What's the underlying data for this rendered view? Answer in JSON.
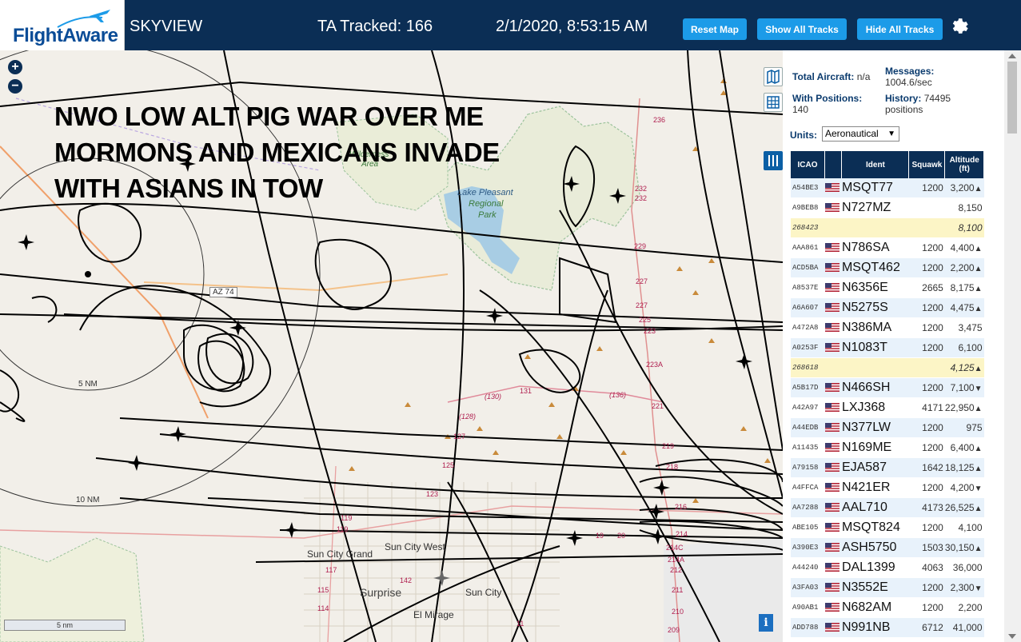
{
  "header": {
    "logo_text": "FlightAware",
    "app_name": "SKYVIEW",
    "tracked": "TA Tracked: 166",
    "clock": "2/1/2020, 8:53:15 AM",
    "buttons": {
      "reset": "Reset Map",
      "show": "Show All Tracks",
      "hide": "Hide All Tracks"
    },
    "colors": {
      "bar": "#0b2e55",
      "button": "#1c9be8"
    }
  },
  "map": {
    "banner_lines": [
      "NWO LOW ALT PIG WAR OVER ME",
      "MORMONS AND MEXICANS INVADE",
      "WITH ASIANS IN TOW"
    ],
    "zoom_in": "+",
    "zoom_out": "−",
    "info": "i",
    "scale": "5 nm",
    "ring_labels": [
      "5 NM",
      "10 NM"
    ],
    "places": {
      "lake": "Lake Pleasant",
      "park": "Regional",
      "park2": "Park",
      "wilderness": "Wilderness",
      "area": "Area",
      "sun_city_grand": "Sun City Grand",
      "sun_city_west": "Sun City West",
      "surprise": "Surprise",
      "sun_city": "Sun City",
      "el_mirage": "El Mirage"
    },
    "routes": {
      "az74": "AZ 74",
      "r236": "236",
      "r232a": "232",
      "r232b": "232",
      "r229": "229",
      "r227a": "227",
      "r227b": "227",
      "r225": "225",
      "r223": "223",
      "r223a": "223A",
      "r221": "221",
      "r219": "219",
      "r218": "218",
      "r216": "216",
      "r214": "214",
      "r214c": "214C",
      "r214a": "214A",
      "r212": "212",
      "r211": "211",
      "r210": "210",
      "r209": "209",
      "r131": "131",
      "r130": "(130)",
      "r136": "(136)",
      "r128": "(128)",
      "r127": "127",
      "r125": "125",
      "r123": "123",
      "r119a": "119",
      "r119b": "119",
      "r117": "117",
      "r115": "115",
      "r114": "114",
      "r142": "142",
      "r19": "19",
      "r20": "20",
      "r11": "11"
    }
  },
  "panel": {
    "total_aircraft_label": "Total Aircraft:",
    "total_aircraft_value": "n/a",
    "with_positions_label": "With Positions:",
    "with_positions_value": "140",
    "messages_label": "Messages:",
    "messages_value": "1004.6/sec",
    "history_label": "History:",
    "history_value": "74495",
    "history_unit": "positions",
    "units_label": "Units:",
    "units_value": "Aeronautical",
    "columns": [
      "ICAO",
      "",
      "Ident",
      "Squawk",
      "Altitude (ft)"
    ],
    "rows": [
      {
        "icao": "A54BE3",
        "flag": "US",
        "ident": "MSQT77",
        "squawk": "1200",
        "alt": "3,200",
        "trend": "▲",
        "hl": false
      },
      {
        "icao": "A9BEB8",
        "flag": "US",
        "ident": "N727MZ",
        "squawk": "",
        "alt": "8,150",
        "trend": "",
        "hl": false
      },
      {
        "icao": "268423",
        "flag": "",
        "ident": "",
        "squawk": "",
        "alt": "8,100",
        "trend": "",
        "hl": true
      },
      {
        "icao": "AAA861",
        "flag": "US",
        "ident": "N786SA",
        "squawk": "1200",
        "alt": "4,400",
        "trend": "▲",
        "hl": false
      },
      {
        "icao": "ACD5BA",
        "flag": "US",
        "ident": "MSQT462",
        "squawk": "1200",
        "alt": "2,200",
        "trend": "▲",
        "hl": false
      },
      {
        "icao": "A8537E",
        "flag": "US",
        "ident": "N6356E",
        "squawk": "2665",
        "alt": "8,175",
        "trend": "▲",
        "hl": false
      },
      {
        "icao": "A6A607",
        "flag": "US",
        "ident": "N5275S",
        "squawk": "1200",
        "alt": "4,475",
        "trend": "▲",
        "hl": false
      },
      {
        "icao": "A472A8",
        "flag": "US",
        "ident": "N386MA",
        "squawk": "1200",
        "alt": "3,475",
        "trend": "",
        "hl": false
      },
      {
        "icao": "A0253F",
        "flag": "US",
        "ident": "N1083T",
        "squawk": "1200",
        "alt": "6,100",
        "trend": "",
        "hl": false
      },
      {
        "icao": "268618",
        "flag": "",
        "ident": "",
        "squawk": "",
        "alt": "4,125",
        "trend": "▲",
        "hl": true
      },
      {
        "icao": "A5B17D",
        "flag": "US",
        "ident": "N466SH",
        "squawk": "1200",
        "alt": "7,100",
        "trend": "▼",
        "hl": false
      },
      {
        "icao": "A42A97",
        "flag": "US",
        "ident": "LXJ368",
        "squawk": "4171",
        "alt": "22,950",
        "trend": "▲",
        "hl": false
      },
      {
        "icao": "A44EDB",
        "flag": "US",
        "ident": "N377LW",
        "squawk": "1200",
        "alt": "975",
        "trend": "",
        "hl": false
      },
      {
        "icao": "A11435",
        "flag": "US",
        "ident": "N169ME",
        "squawk": "1200",
        "alt": "6,400",
        "trend": "▲",
        "hl": false
      },
      {
        "icao": "A79158",
        "flag": "US",
        "ident": "EJA587",
        "squawk": "1642",
        "alt": "18,125",
        "trend": "▲",
        "hl": false
      },
      {
        "icao": "A4FFCA",
        "flag": "US",
        "ident": "N421ER",
        "squawk": "1200",
        "alt": "4,200",
        "trend": "▼",
        "hl": false
      },
      {
        "icao": "AA7288",
        "flag": "US",
        "ident": "AAL710",
        "squawk": "4173",
        "alt": "26,525",
        "trend": "▲",
        "hl": false
      },
      {
        "icao": "ABE105",
        "flag": "US",
        "ident": "MSQT824",
        "squawk": "1200",
        "alt": "4,100",
        "trend": "",
        "hl": false
      },
      {
        "icao": "A390E3",
        "flag": "US",
        "ident": "ASH5750",
        "squawk": "1503",
        "alt": "30,150",
        "trend": "▲",
        "hl": false
      },
      {
        "icao": "A44240",
        "flag": "US",
        "ident": "DAL1399",
        "squawk": "4063",
        "alt": "36,000",
        "trend": "",
        "hl": false
      },
      {
        "icao": "A3FA03",
        "flag": "US",
        "ident": "N3552E",
        "squawk": "1200",
        "alt": "2,300",
        "trend": "▼",
        "hl": false
      },
      {
        "icao": "A90AB1",
        "flag": "US",
        "ident": "N682AM",
        "squawk": "1200",
        "alt": "2,200",
        "trend": "",
        "hl": false
      },
      {
        "icao": "ADD788",
        "flag": "US",
        "ident": "N991NB",
        "squawk": "6712",
        "alt": "41,000",
        "trend": "",
        "hl": false
      }
    ]
  }
}
